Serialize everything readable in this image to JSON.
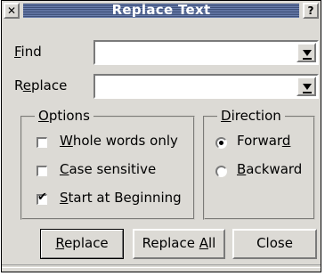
{
  "window": {
    "title": "Replace Text",
    "close_glyph": "✕",
    "help_glyph": "?"
  },
  "find": {
    "label_prefix": "",
    "label_mnemonic": "F",
    "label_suffix": "ind",
    "value": ""
  },
  "replace": {
    "label_prefix": "R",
    "label_mnemonic": "e",
    "label_suffix": "place",
    "value": ""
  },
  "options": {
    "legend_prefix": "",
    "legend_mnemonic": "O",
    "legend_suffix": "ptions",
    "items": [
      {
        "prefix": "",
        "mnemonic": "W",
        "suffix": "hole words only",
        "checked": false
      },
      {
        "prefix": "",
        "mnemonic": "C",
        "suffix": "ase sensitive",
        "checked": false
      },
      {
        "prefix": "",
        "mnemonic": "S",
        "suffix": "tart at Beginning",
        "checked": true
      }
    ]
  },
  "direction": {
    "legend_prefix": "",
    "legend_mnemonic": "D",
    "legend_suffix": "irection",
    "items": [
      {
        "prefix": "Forwar",
        "mnemonic": "d",
        "suffix": "",
        "selected": true
      },
      {
        "prefix": "",
        "mnemonic": "B",
        "suffix": "ackward",
        "selected": false
      }
    ]
  },
  "buttons": {
    "replace": {
      "prefix": "",
      "mnemonic": "R",
      "suffix": "eplace"
    },
    "replace_all": {
      "prefix": "Replace ",
      "mnemonic": "A",
      "suffix": "ll"
    },
    "close": {
      "prefix": "Close",
      "mnemonic": "",
      "suffix": ""
    }
  },
  "icons": {
    "dropdown": "chevron-down-icon",
    "check": "checkmark-icon"
  }
}
